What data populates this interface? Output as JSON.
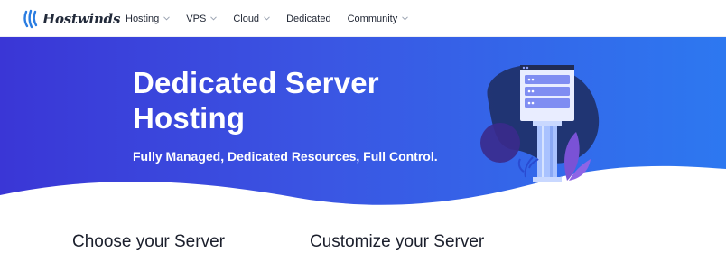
{
  "brand": {
    "name": "Hostwinds",
    "logo_icon": "hostwinds-logo-icon"
  },
  "nav": {
    "items": [
      {
        "label": "Hosting",
        "has_dropdown": true
      },
      {
        "label": "VPS",
        "has_dropdown": true
      },
      {
        "label": "Cloud",
        "has_dropdown": true
      },
      {
        "label": "Dedicated",
        "has_dropdown": false
      },
      {
        "label": "Community",
        "has_dropdown": true
      }
    ]
  },
  "hero": {
    "title": "Dedicated Server Hosting",
    "subtitle": "Fully Managed, Dedicated Resources, Full Control.",
    "illustration": "server-pillar-illustration",
    "colors": {
      "gradient_start": "#3a36d6",
      "gradient_end": "#2d78f0",
      "accent_dark": "#1d2b5e",
      "plant": "#7a52d6"
    }
  },
  "sections": {
    "left_heading": "Choose your Server",
    "right_heading": "Customize your Server"
  }
}
